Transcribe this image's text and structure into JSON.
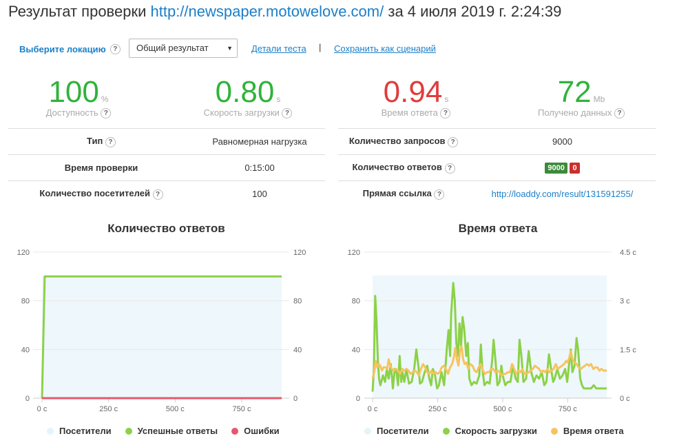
{
  "header": {
    "title_prefix": "Результат проверки",
    "url": "http://newspaper.motowelove.com/",
    "title_suffix": "за 4 июля 2019 г. 2:24:39"
  },
  "toolbar": {
    "location_label": "Выберите локацию",
    "help": "?",
    "location_value": "Общий результат",
    "details_link": "Детали теста",
    "separator": "|",
    "save_link": "Сохранить как сценарий"
  },
  "metrics": [
    {
      "value": "100",
      "unit": "%",
      "label": "Доступность",
      "color": "#2fb33b"
    },
    {
      "value": "0.80",
      "unit": "s",
      "label": "Скорость загрузки",
      "color": "#2fb33b"
    },
    {
      "value": "0.94",
      "unit": "s",
      "label": "Время ответа",
      "color": "#e03c3c"
    },
    {
      "value": "72",
      "unit": "Mb",
      "label": "Получено данных",
      "color": "#2fb33b"
    }
  ],
  "info_left": [
    {
      "key": "Тип",
      "value": "Равномерная нагрузка"
    },
    {
      "key": "Время проверки",
      "value": "0:15:00"
    },
    {
      "key": "Количество посетителей",
      "value": "100"
    }
  ],
  "info_right": [
    {
      "key": "Количество запросов",
      "value": "9000"
    },
    {
      "key": "Количество ответов",
      "ok": "9000",
      "err": "0"
    },
    {
      "key": "Прямая ссылка",
      "value": "http://loaddy.com/result/131591255/"
    }
  ],
  "chart_data": [
    {
      "type": "line",
      "title": "Количество ответов",
      "xlim": [
        0,
        900
      ],
      "ylim": [
        0,
        120
      ],
      "x_ticks": [
        "0 с",
        "250 с",
        "500 с",
        "750 с"
      ],
      "y_ticks_left": [
        "0",
        "40",
        "80",
        "120"
      ],
      "y_ticks_right": [
        "0",
        "40",
        "80",
        "120"
      ],
      "series": [
        {
          "name": "Посетители",
          "color": "#e5f3fb",
          "points": [
            [
              0,
              0
            ],
            [
              900,
              0
            ]
          ]
        },
        {
          "name": "Успешные ответы",
          "color": "#8cd148",
          "points": [
            [
              0,
              0
            ],
            [
              10,
              100
            ],
            [
              900,
              100
            ]
          ]
        },
        {
          "name": "Ошибки",
          "color": "#e5586a",
          "points": [
            [
              0,
              0
            ],
            [
              900,
              0
            ]
          ]
        }
      ]
    },
    {
      "type": "line",
      "title": "Время ответа",
      "xlim": [
        0,
        900
      ],
      "ylim_left": [
        0,
        120
      ],
      "ylim_right": [
        0,
        4.5
      ],
      "x_ticks": [
        "0 с",
        "250 с",
        "500 с",
        "750 с"
      ],
      "y_ticks_left": [
        "0",
        "40",
        "80",
        "120"
      ],
      "y_ticks_right": [
        "0 с",
        "1.5 с",
        "3 с",
        "4.5 с"
      ],
      "series": [
        {
          "name": "Посетители",
          "color": "#e5f3fb",
          "axis": "left",
          "points": [
            [
              0,
              100
            ],
            [
              900,
              100
            ]
          ]
        },
        {
          "name": "Скорость загрузки",
          "color": "#8cd148",
          "axis": "right",
          "points": [
            [
              0,
              0.2
            ],
            [
              5,
              0.9
            ],
            [
              10,
              3.15
            ],
            [
              15,
              2.4
            ],
            [
              20,
              1.2
            ],
            [
              25,
              0.6
            ],
            [
              30,
              0.4
            ],
            [
              40,
              0.7
            ],
            [
              48,
              0.5
            ],
            [
              55,
              0.9
            ],
            [
              62,
              0.6
            ],
            [
              70,
              1.05
            ],
            [
              78,
              0.3
            ],
            [
              85,
              0.9
            ],
            [
              92,
              0.8
            ],
            [
              98,
              0.4
            ],
            [
              104,
              1.3
            ],
            [
              110,
              0.5
            ],
            [
              115,
              0.8
            ],
            [
              122,
              0.5
            ],
            [
              130,
              0.9
            ],
            [
              140,
              0.45
            ],
            [
              150,
              0.5
            ],
            [
              160,
              0.9
            ],
            [
              168,
              1.5
            ],
            [
              176,
              1.0
            ],
            [
              182,
              0.45
            ],
            [
              190,
              0.5
            ],
            [
              200,
              0.8
            ],
            [
              210,
              1.0
            ],
            [
              218,
              0.6
            ],
            [
              225,
              0.4
            ],
            [
              232,
              0.9
            ],
            [
              240,
              0.7
            ],
            [
              248,
              0.3
            ],
            [
              255,
              0.4
            ],
            [
              265,
              0.8
            ],
            [
              275,
              0.4
            ],
            [
              285,
              1.5
            ],
            [
              292,
              2.1
            ],
            [
              298,
              1.3
            ],
            [
              302,
              2.6
            ],
            [
              310,
              3.55
            ],
            [
              316,
              3.0
            ],
            [
              322,
              1.7
            ],
            [
              328,
              1.3
            ],
            [
              334,
              2.3
            ],
            [
              340,
              1.6
            ],
            [
              346,
              2.5
            ],
            [
              352,
              2.15
            ],
            [
              360,
              1.3
            ],
            [
              366,
              1.7
            ],
            [
              372,
              0.6
            ],
            [
              380,
              0.4
            ],
            [
              390,
              0.5
            ],
            [
              400,
              0.45
            ],
            [
              410,
              0.7
            ],
            [
              416,
              1.65
            ],
            [
              422,
              0.9
            ],
            [
              430,
              0.4
            ],
            [
              440,
              0.5
            ],
            [
              450,
              0.45
            ],
            [
              460,
              1.2
            ],
            [
              465,
              1.8
            ],
            [
              472,
              1.2
            ],
            [
              480,
              0.4
            ],
            [
              488,
              0.5
            ],
            [
              495,
              1.0
            ],
            [
              500,
              0.7
            ],
            [
              510,
              0.4
            ],
            [
              520,
              0.5
            ],
            [
              530,
              0.5
            ],
            [
              540,
              1.0
            ],
            [
              550,
              0.6
            ],
            [
              558,
              0.5
            ],
            [
              565,
              1.8
            ],
            [
              572,
              1.3
            ],
            [
              580,
              0.5
            ],
            [
              590,
              0.6
            ],
            [
              600,
              1.45
            ],
            [
              610,
              0.8
            ],
            [
              620,
              0.5
            ],
            [
              630,
              0.7
            ],
            [
              640,
              0.6
            ],
            [
              650,
              0.8
            ],
            [
              660,
              0.4
            ],
            [
              668,
              0.5
            ],
            [
              678,
              1.35
            ],
            [
              686,
              0.9
            ],
            [
              694,
              0.5
            ],
            [
              700,
              0.6
            ],
            [
              710,
              0.9
            ],
            [
              720,
              0.6
            ],
            [
              730,
              0.7
            ],
            [
              740,
              0.9
            ],
            [
              748,
              0.5
            ],
            [
              756,
              1.1
            ],
            [
              762,
              1.5
            ],
            [
              768,
              0.8
            ],
            [
              776,
              1.0
            ],
            [
              784,
              1.85
            ],
            [
              790,
              1.5
            ],
            [
              798,
              0.6
            ],
            [
              805,
              0.4
            ],
            [
              812,
              0.3
            ],
            [
              820,
              0.3
            ],
            [
              830,
              0.3
            ],
            [
              840,
              0.3
            ],
            [
              850,
              0.4
            ],
            [
              860,
              0.3
            ],
            [
              870,
              0.3
            ],
            [
              880,
              0.3
            ],
            [
              890,
              0.3
            ],
            [
              900,
              0.3
            ]
          ]
        },
        {
          "name": "Время ответа",
          "color": "#f7c35f",
          "axis": "right",
          "points": [
            [
              0,
              0.6
            ],
            [
              6,
              0.8
            ],
            [
              12,
              1.15
            ],
            [
              18,
              0.95
            ],
            [
              24,
              1.05
            ],
            [
              30,
              1.0
            ],
            [
              36,
              0.85
            ],
            [
              42,
              0.95
            ],
            [
              50,
              0.95
            ],
            [
              56,
              0.9
            ],
            [
              62,
              1.2
            ],
            [
              68,
              1.0
            ],
            [
              74,
              0.9
            ],
            [
              82,
              0.85
            ],
            [
              90,
              0.9
            ],
            [
              98,
              0.85
            ],
            [
              106,
              0.75
            ],
            [
              114,
              0.9
            ],
            [
              122,
              0.85
            ],
            [
              130,
              0.9
            ],
            [
              138,
              0.85
            ],
            [
              146,
              0.75
            ],
            [
              154,
              0.8
            ],
            [
              162,
              0.85
            ],
            [
              170,
              0.8
            ],
            [
              178,
              0.7
            ],
            [
              186,
              0.9
            ],
            [
              194,
              1.05
            ],
            [
              202,
              0.95
            ],
            [
              210,
              0.8
            ],
            [
              218,
              0.75
            ],
            [
              226,
              0.85
            ],
            [
              234,
              0.75
            ],
            [
              242,
              0.8
            ],
            [
              250,
              0.75
            ],
            [
              258,
              0.8
            ],
            [
              266,
              0.95
            ],
            [
              274,
              1.0
            ],
            [
              282,
              0.9
            ],
            [
              290,
              0.75
            ],
            [
              298,
              0.95
            ],
            [
              306,
              1.05
            ],
            [
              312,
              1.25
            ],
            [
              318,
              1.55
            ],
            [
              324,
              1.2
            ],
            [
              330,
              1.0
            ],
            [
              336,
              1.45
            ],
            [
              342,
              1.6
            ],
            [
              348,
              1.2
            ],
            [
              354,
              1.05
            ],
            [
              360,
              1.1
            ],
            [
              368,
              0.9
            ],
            [
              376,
              1.05
            ],
            [
              384,
              1.0
            ],
            [
              392,
              0.85
            ],
            [
              400,
              0.8
            ],
            [
              408,
              0.95
            ],
            [
              416,
              1.05
            ],
            [
              424,
              0.85
            ],
            [
              432,
              0.75
            ],
            [
              440,
              0.8
            ],
            [
              448,
              0.8
            ],
            [
              456,
              0.9
            ],
            [
              464,
              0.9
            ],
            [
              472,
              0.8
            ],
            [
              480,
              0.85
            ],
            [
              488,
              0.8
            ],
            [
              496,
              0.7
            ],
            [
              504,
              0.75
            ],
            [
              512,
              0.75
            ],
            [
              520,
              0.8
            ],
            [
              528,
              0.8
            ],
            [
              536,
              1.05
            ],
            [
              544,
              0.9
            ],
            [
              552,
              0.75
            ],
            [
              560,
              0.85
            ],
            [
              568,
              0.8
            ],
            [
              576,
              0.9
            ],
            [
              584,
              0.75
            ],
            [
              592,
              0.75
            ],
            [
              600,
              0.8
            ],
            [
              608,
              0.85
            ],
            [
              616,
              0.9
            ],
            [
              624,
              1.0
            ],
            [
              632,
              0.95
            ],
            [
              640,
              0.9
            ],
            [
              648,
              0.8
            ],
            [
              656,
              0.85
            ],
            [
              664,
              0.8
            ],
            [
              672,
              0.9
            ],
            [
              680,
              0.8
            ],
            [
              688,
              0.85
            ],
            [
              696,
              0.9
            ],
            [
              704,
              1.05
            ],
            [
              712,
              0.9
            ],
            [
              720,
              0.95
            ],
            [
              728,
              1.0
            ],
            [
              736,
              1.05
            ],
            [
              744,
              1.15
            ],
            [
              750,
              1.1
            ],
            [
              756,
              1.25
            ],
            [
              762,
              1.45
            ],
            [
              768,
              1.2
            ],
            [
              776,
              1.1
            ],
            [
              784,
              1.05
            ],
            [
              792,
              0.95
            ],
            [
              800,
              0.9
            ],
            [
              808,
              0.95
            ],
            [
              816,
              1.0
            ],
            [
              824,
              1.05
            ],
            [
              832,
              1.0
            ],
            [
              840,
              1.05
            ],
            [
              848,
              0.9
            ],
            [
              856,
              0.95
            ],
            [
              864,
              0.95
            ],
            [
              872,
              0.85
            ],
            [
              880,
              0.9
            ],
            [
              888,
              0.85
            ],
            [
              896,
              0.85
            ],
            [
              900,
              0.85
            ]
          ]
        }
      ]
    }
  ]
}
